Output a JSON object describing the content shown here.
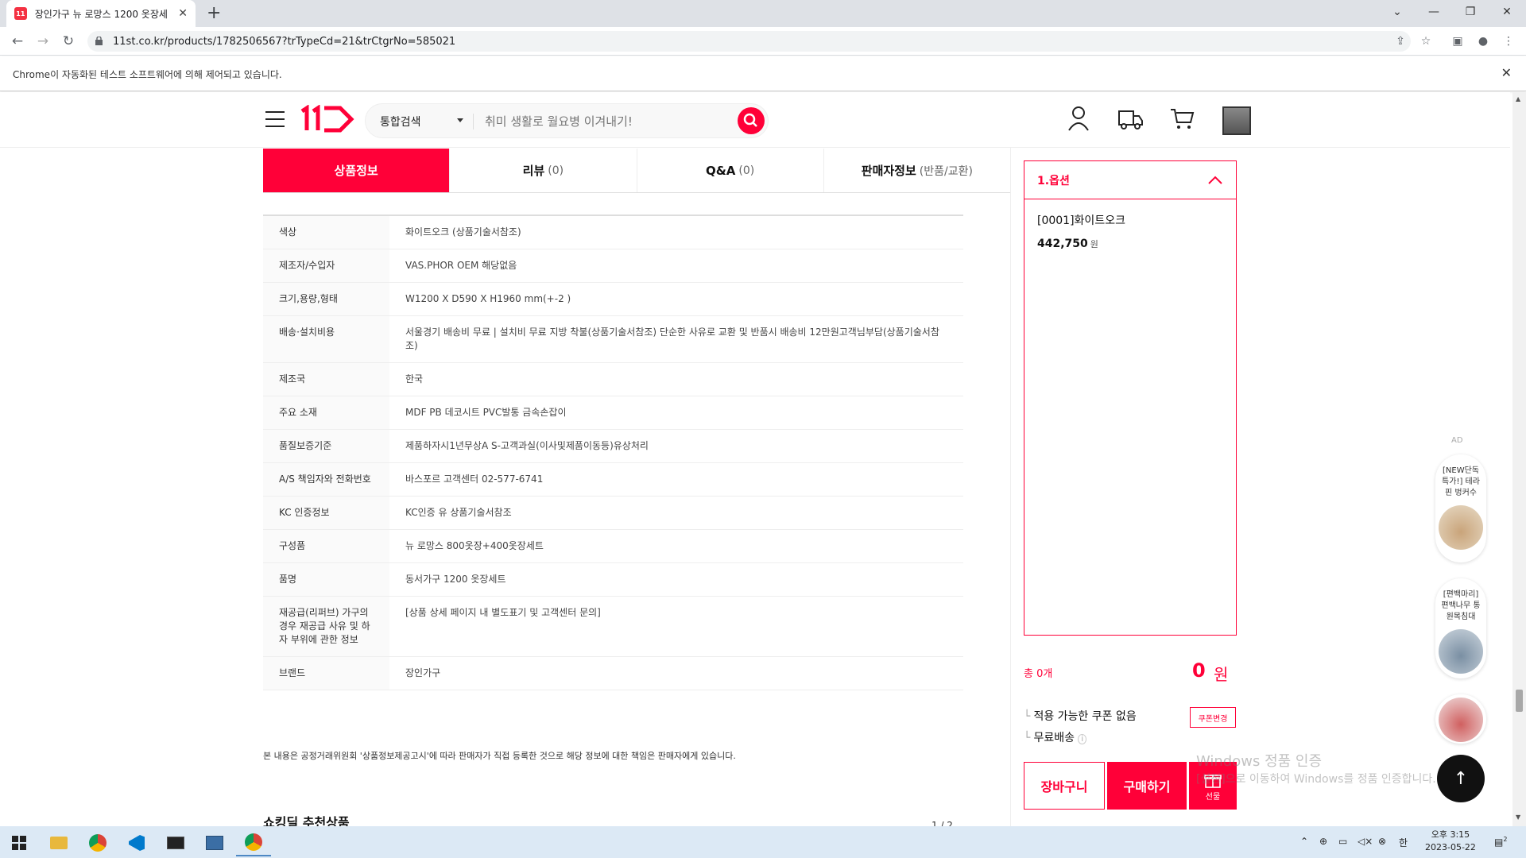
{
  "browser": {
    "tab_title": "장인가구 뉴 로망스 1200 옷장세",
    "favicon_text": "11",
    "url": "11st.co.kr/products/1782506567?trTypeCd=21&trCtgrNo=585021",
    "infobar_text": "Chrome이 자동화된 테스트 소프트웨어에 의해 제어되고 있습니다."
  },
  "header": {
    "search_category": "통합검색",
    "search_placeholder": "취미 생활로 월요병 이겨내기!"
  },
  "tabs": [
    {
      "label": "상품정보",
      "count": ""
    },
    {
      "label": "리뷰",
      "count": "(0)"
    },
    {
      "label": "Q&A",
      "count": "(0)"
    },
    {
      "label": "판매자정보",
      "count": "(반품/교환)"
    }
  ],
  "info_rows": [
    {
      "key": "색상",
      "value": "화이트오크 (상품기술서참조)"
    },
    {
      "key": "제조자/수입자",
      "value": "VAS.PHOR OEM 해당없음"
    },
    {
      "key": "크기,용량,형태",
      "value": "W1200 X D590 X H1960 mm(+-2 )"
    },
    {
      "key": "배송·설치비용",
      "value": "서울경기 배송비 무료 | 설치비 무료 지방 착불(상품기술서참조) 단순한 사유로 교환 및 반품시 배송비 12만원고객님부담(상품기술서참조)"
    },
    {
      "key": "제조국",
      "value": "한국"
    },
    {
      "key": "주요 소재",
      "value": "MDF PB 데코시트 PVC발통 금속손잡이"
    },
    {
      "key": "품질보증기준",
      "value": "제품하자시1년무상A S-고객과실(이사및제품이동등)유상처리"
    },
    {
      "key": "A/S 책임자와 전화번호",
      "value": "바스포르 고객센터 02-577-6741"
    },
    {
      "key": "KC 인증정보",
      "value": "KC인증 유 상품기술서참조"
    },
    {
      "key": "구성품",
      "value": "뉴 로망스 800옷장+400옷장세트"
    },
    {
      "key": "품명",
      "value": "동서가구 1200 옷장세트"
    },
    {
      "key": "재공급(리퍼브) 가구의 경우 재공급 사유 및 하자 부위에 관한 정보",
      "value": "[상품 상세 페이지 내 별도표기 및 고객센터 문의]"
    },
    {
      "key": "브랜드",
      "value": "장인가구"
    }
  ],
  "notice": "본 내용은 공정거래위원회 '상품정보제공고시'에 따라 판매자가 직접 등록한 것으로 해당 정보에 대한 책임은 판매자에게 있습니다.",
  "reco_title": "쇼킹딜 추천상품",
  "reco_page": "1 / 2",
  "option": {
    "title": "1.옵션",
    "item_name": "[0001]화이트오크",
    "item_price": "442,750",
    "price_unit": "원"
  },
  "total": {
    "label": "총 0개",
    "value": "0",
    "unit": "원"
  },
  "coupon_text": "적용 가능한 쿠폰 없음",
  "coupon_button": "쿠폰변경",
  "shipping_text": "무료배송",
  "buttons": {
    "cart": "장바구니",
    "buy": "구매하기",
    "gift": "선물"
  },
  "ads": {
    "label": "AD",
    "items": [
      "[NEW단독특가!] 테라핀 벙커수",
      "[편백마리]편백나무 통원목침대"
    ]
  },
  "watermark": {
    "line1": "Windows 정품 인증",
    "line2": "[설정]으로 이동하여 Windows를 정품 인증합니다."
  },
  "taskbar": {
    "ime": "한",
    "time": "오후 3:15",
    "date": "2023-05-22",
    "notif_count": "2"
  },
  "colors": {
    "brand": "#ff0038"
  }
}
